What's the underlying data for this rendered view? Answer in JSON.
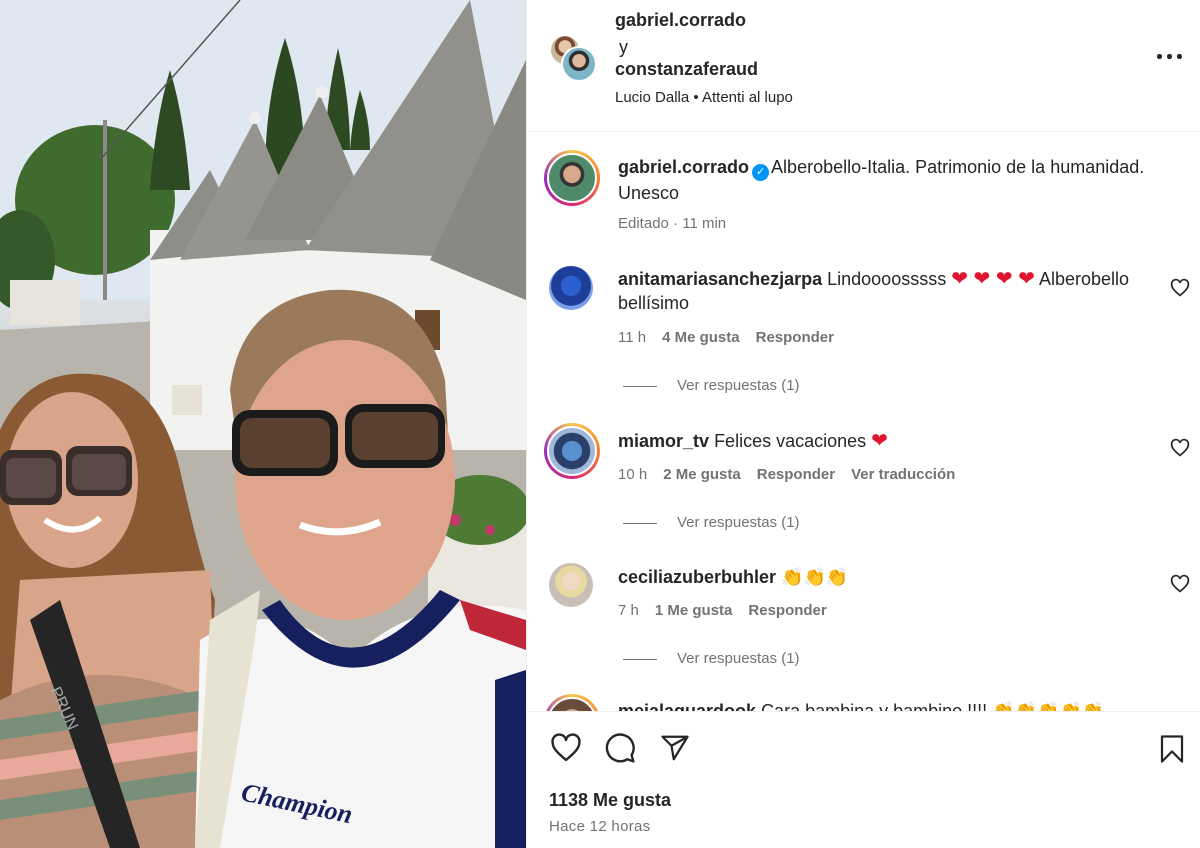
{
  "post": {
    "image_alt": "Selfie of a couple in Alberobello",
    "shirt_brand": "Champion",
    "bag_strap_text": "PRUN"
  },
  "header": {
    "user1": "gabriel.corrado",
    "connector": "y",
    "user2": "constanzaferaud",
    "audio_artist": "Lucio Dalla",
    "audio_separator": "•",
    "audio_song": "Attenti al lupo"
  },
  "caption": {
    "username": "gabriel.corrado",
    "text": "Alberobello-Italia. Patrimonio de la humanidad. Unesco",
    "edited": "Editado",
    "time": "11 min"
  },
  "comments": [
    {
      "username": "anitamariasanchezjarpa",
      "text_before": "Lindoooosssss",
      "emoji": "❤ ❤ ❤ ❤",
      "text_after": "Alberobello bellísimo",
      "time": "11 h",
      "likes": "4 Me gusta",
      "reply": "Responder",
      "view_replies": "Ver respuestas (1)"
    },
    {
      "username": "miamor_tv",
      "text_before": "Felices vacaciones",
      "emoji": "❤",
      "time": "10 h",
      "likes": "2 Me gusta",
      "reply": "Responder",
      "translate": "Ver traducción",
      "view_replies": "Ver respuestas (1)"
    },
    {
      "username": "ceciliazuberbuhler",
      "emoji": "👏👏👏",
      "time": "7 h",
      "likes": "1 Me gusta",
      "reply": "Responder",
      "view_replies": "Ver respuestas (1)"
    },
    {
      "username": "meialaguardook",
      "text_before": "Cara bambina y bambino !!!!",
      "emoji": "👏👏👏👏👏"
    }
  ],
  "footer": {
    "likes": "1138 Me gusta",
    "time": "Hace 12 horas"
  }
}
